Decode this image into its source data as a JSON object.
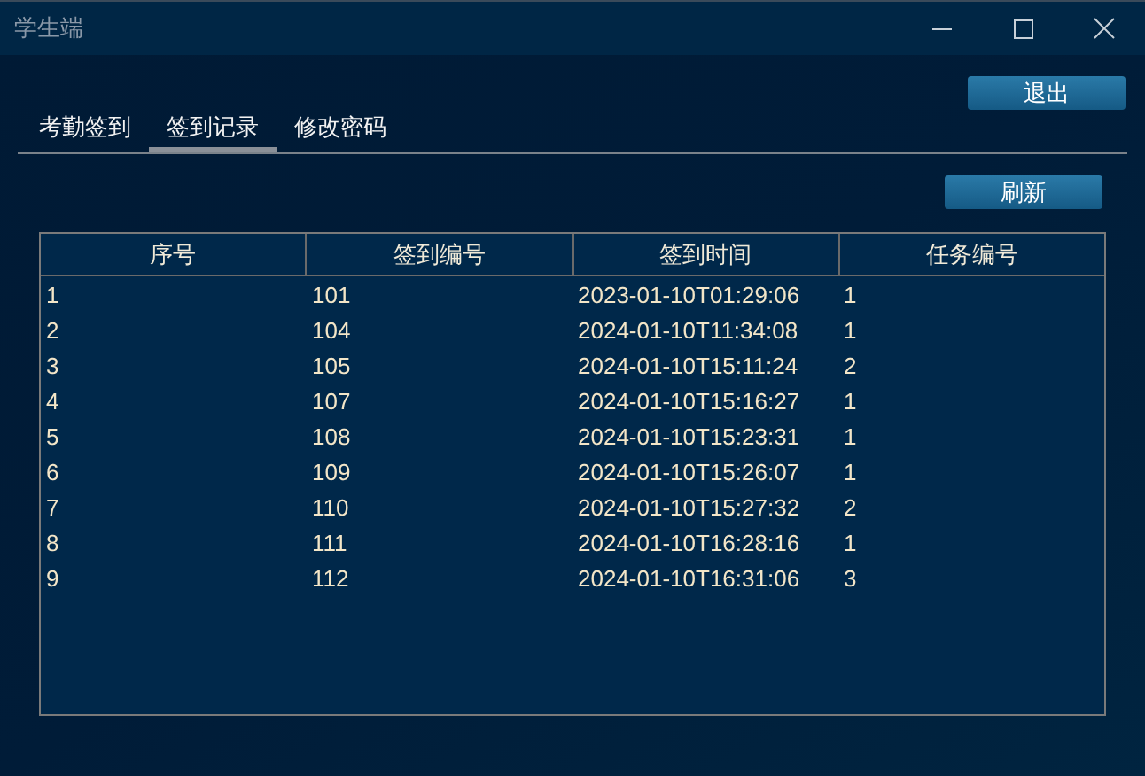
{
  "window": {
    "title": "学生端"
  },
  "logout_button": "退出",
  "tabs": [
    {
      "label": "考勤签到",
      "selected": false
    },
    {
      "label": "签到记录",
      "selected": true
    },
    {
      "label": "修改密码",
      "selected": false
    }
  ],
  "refresh_button": "刷新",
  "table": {
    "columns": [
      "序号",
      "签到编号",
      "签到时间",
      "任务编号"
    ],
    "rows": [
      [
        "1",
        "101",
        "2023-01-10T01:29:06",
        "1"
      ],
      [
        "2",
        "104",
        "2024-01-10T11:34:08",
        "1"
      ],
      [
        "3",
        "105",
        "2024-01-10T15:11:24",
        "2"
      ],
      [
        "4",
        "107",
        "2024-01-10T15:16:27",
        "1"
      ],
      [
        "5",
        "108",
        "2024-01-10T15:23:31",
        "1"
      ],
      [
        "6",
        "109",
        "2024-01-10T15:26:07",
        "1"
      ],
      [
        "7",
        "110",
        "2024-01-10T15:27:32",
        "2"
      ],
      [
        "8",
        "111",
        "2024-01-10T16:28:16",
        "1"
      ],
      [
        "9",
        "112",
        "2024-01-10T16:31:06",
        "3"
      ]
    ]
  }
}
